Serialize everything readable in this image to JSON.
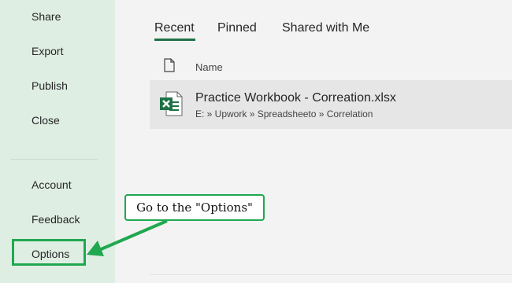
{
  "sidebar": {
    "items": [
      {
        "label": "Share"
      },
      {
        "label": "Export"
      },
      {
        "label": "Publish"
      },
      {
        "label": "Close"
      }
    ],
    "bottom_items": [
      {
        "label": "Account"
      },
      {
        "label": "Feedback"
      },
      {
        "label": "Options"
      }
    ]
  },
  "tabs": [
    {
      "label": "Recent",
      "active": true
    },
    {
      "label": "Pinned"
    },
    {
      "label": "Shared with Me"
    }
  ],
  "file_list": {
    "column_header": "Name",
    "files": [
      {
        "name": "Practice Workbook - Correation.xlsx",
        "path": "E: » Upwork » Spreadsheeto » Correlation",
        "icon": "excel-file-icon"
      }
    ]
  },
  "annotation": {
    "callout_text": "Go to the \"Options\"",
    "accent_color": "#1fa84f"
  },
  "colors": {
    "sidebar_bg": "#dfeee3",
    "excel_green": "#1e7145"
  }
}
